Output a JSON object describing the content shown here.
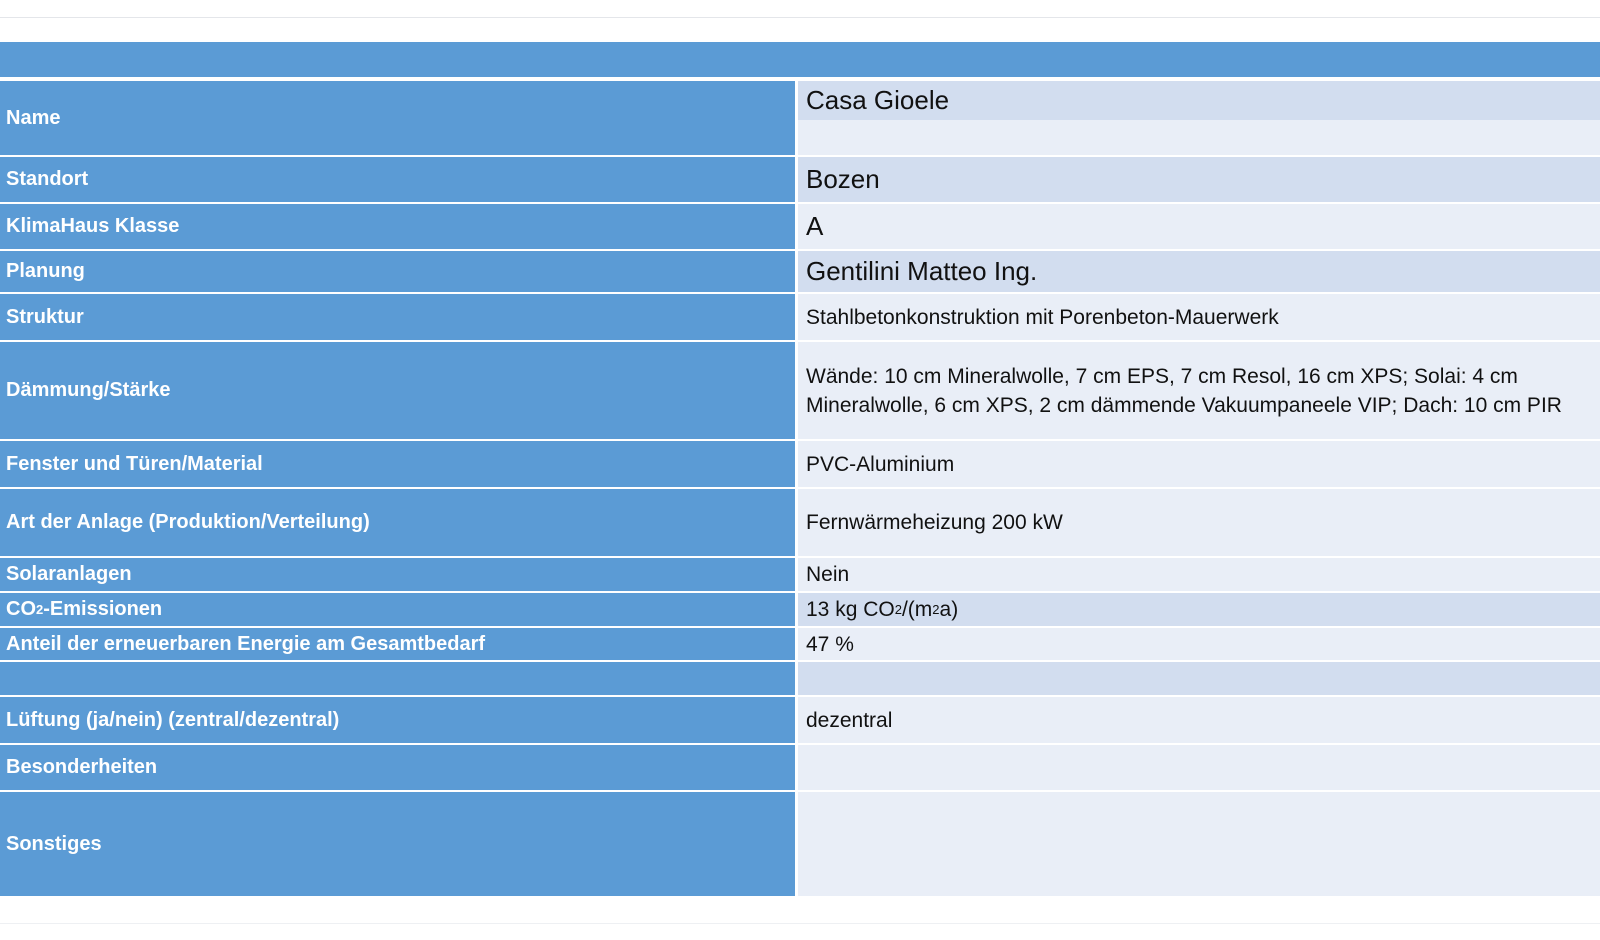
{
  "rows": [
    {
      "label": "Name",
      "value": "Casa Gioele"
    },
    {
      "label": "Standort",
      "value": "Bozen"
    },
    {
      "label": "KlimaHaus Klasse",
      "value": "A"
    },
    {
      "label": "Planung",
      "value": "Gentilini Matteo Ing."
    },
    {
      "label": "Struktur",
      "value": "Stahlbetonkonstruktion mit Porenbeton-Mauerwerk"
    },
    {
      "label": "Dämmung/Stärke",
      "value_line1": "Wände: 10 cm Mineralwolle, 7 cm EPS, 7 cm Resol, 16 cm XPS; Solai: 4 cm",
      "value_line2": "Mineralwolle, 6 cm XPS, 2 cm dämmende Vakuumpaneele VIP; Dach: 10 cm PIR"
    },
    {
      "label": "Fenster und Türen/Material",
      "value": "PVC-Aluminium"
    },
    {
      "label": "Art der Anlage (Produktion/Verteilung)",
      "value": "Fernwärmeheizung 200 kW"
    },
    {
      "label": "Solaranlagen",
      "value": "Nein"
    },
    {
      "label_pre": "CO",
      "label_sub": "2",
      "label_post": "-Emissionen",
      "value_pre": "13 kg CO",
      "value_sub": "2",
      "value_mid": "/(m",
      "value_sup": "2",
      "value_post": "a)"
    },
    {
      "label": "Anteil der erneuerbaren Energie am Gesamtbedarf",
      "value": "47 %"
    },
    {
      "label": "",
      "value": ""
    },
    {
      "label": "Lüftung (ja/nein) (zentral/dezentral)",
      "value": "dezentral"
    },
    {
      "label": "Besonderheiten",
      "value": ""
    },
    {
      "label": "Sonstiges",
      "value": ""
    }
  ]
}
